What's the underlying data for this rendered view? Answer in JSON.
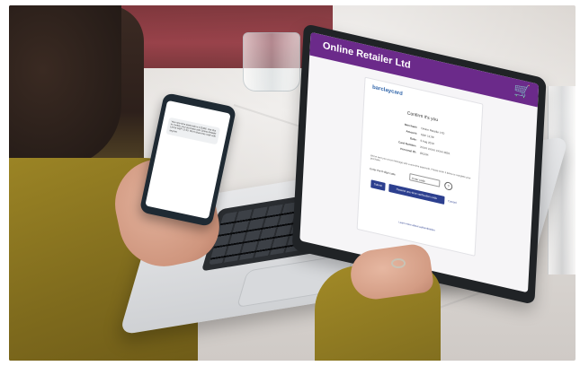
{
  "laptop_site": {
    "header_title": "Online Retailer Ltd",
    "basket_icon": "basket-icon",
    "logo_text": "barclaycard",
    "card_title": "Confirm it's you",
    "fields": [
      {
        "label": "Merchant:",
        "value": "Online Retailer LTD"
      },
      {
        "label": "Amount:",
        "value": "GBP 12.99"
      },
      {
        "label": "Date:",
        "value": "5 Aug 2019"
      },
      {
        "label": "Card Number:",
        "value": "XXXX XXXX XXXX 0001"
      },
      {
        "label": "Personal ID:",
        "value": "ID1234"
      }
    ],
    "instructions": "We've sent you a text message with a one-time passcode. Please enter it below to complete your purchase.",
    "code_label": "Enter the 6-digit code",
    "code_value": "Enter code",
    "help_icon": "help-icon",
    "submit_label": "Submit",
    "resend_label": "Resend one-time verification code",
    "cancel_label": "Cancel",
    "learn_more": "Learn more about authentication"
  },
  "phone": {
    "message": "Your one-time passcode is 123456. Use this to confirm your purchase with Online Retailer Ltd for GBP 12.99. Don't share this code with anyone."
  }
}
